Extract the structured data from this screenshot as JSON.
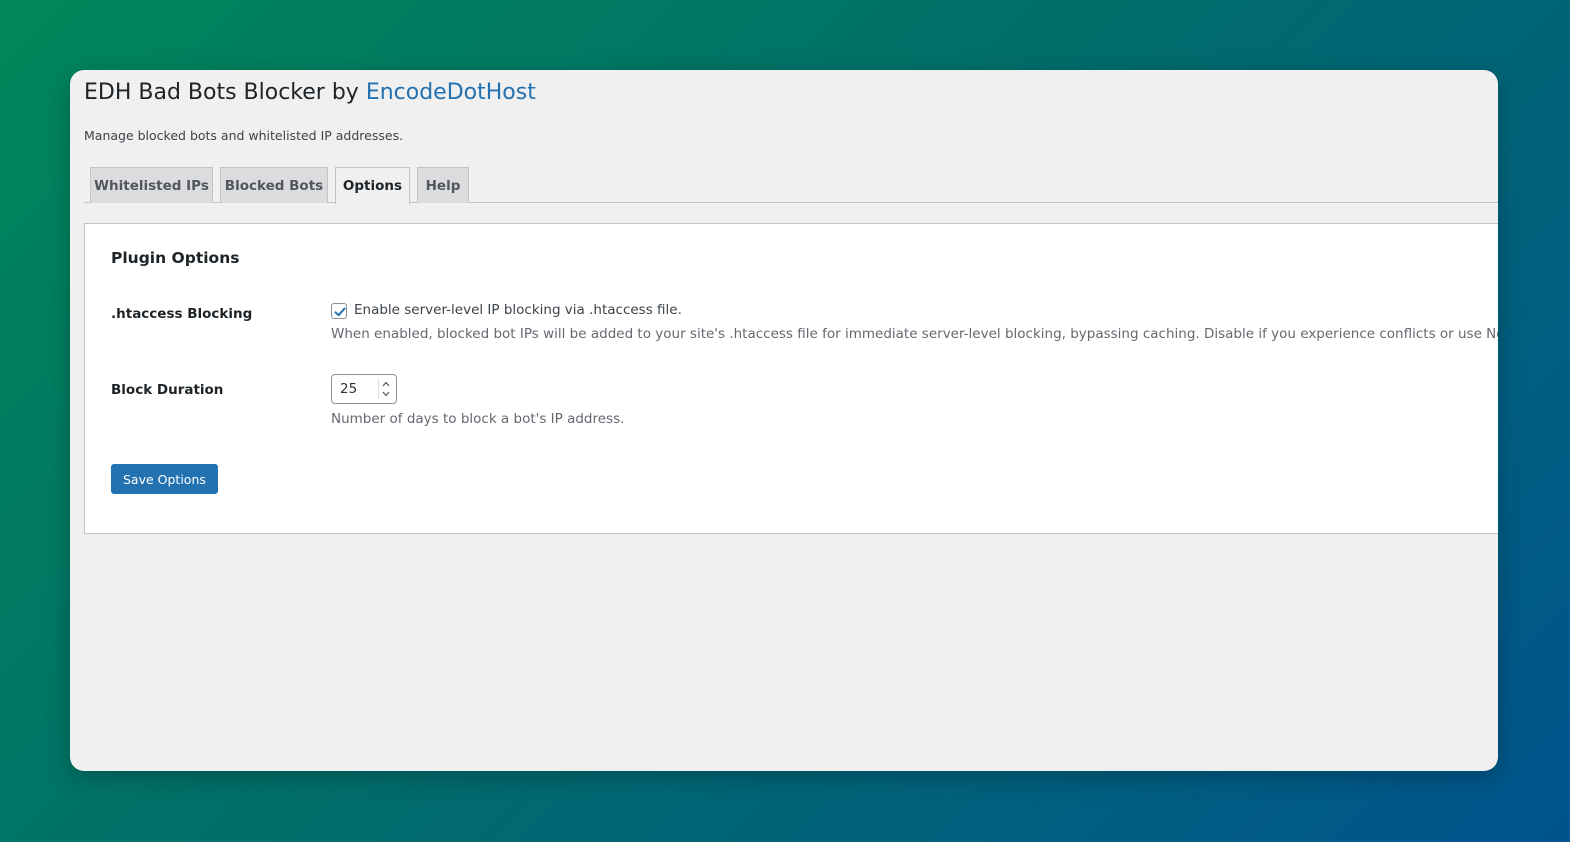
{
  "header": {
    "title_prefix": "EDH Bad Bots Blocker by ",
    "title_link": "EncodeDotHost",
    "subtitle": "Manage blocked bots and whitelisted IP addresses."
  },
  "tabs": [
    {
      "label": "Whitelisted IPs",
      "active": false
    },
    {
      "label": "Blocked Bots",
      "active": false
    },
    {
      "label": "Options",
      "active": true
    },
    {
      "label": "Help",
      "active": false
    }
  ],
  "options": {
    "section_title": "Plugin Options",
    "htaccess": {
      "label": ".htaccess Blocking",
      "checked": true,
      "checkbox_label": "Enable server-level IP blocking via .htaccess file.",
      "description": "When enabled, blocked bot IPs will be added to your site's .htaccess file for immediate server-level blocking, bypassing caching. Disable if you experience conflicts or use Nginx."
    },
    "block_duration": {
      "label": "Block Duration",
      "value": "25",
      "description": "Number of days to block a bot's IP address."
    },
    "save_label": "Save Options"
  },
  "colors": {
    "accent": "#2271b1",
    "gradient_start": "#00875a",
    "gradient_end": "#00548e"
  }
}
